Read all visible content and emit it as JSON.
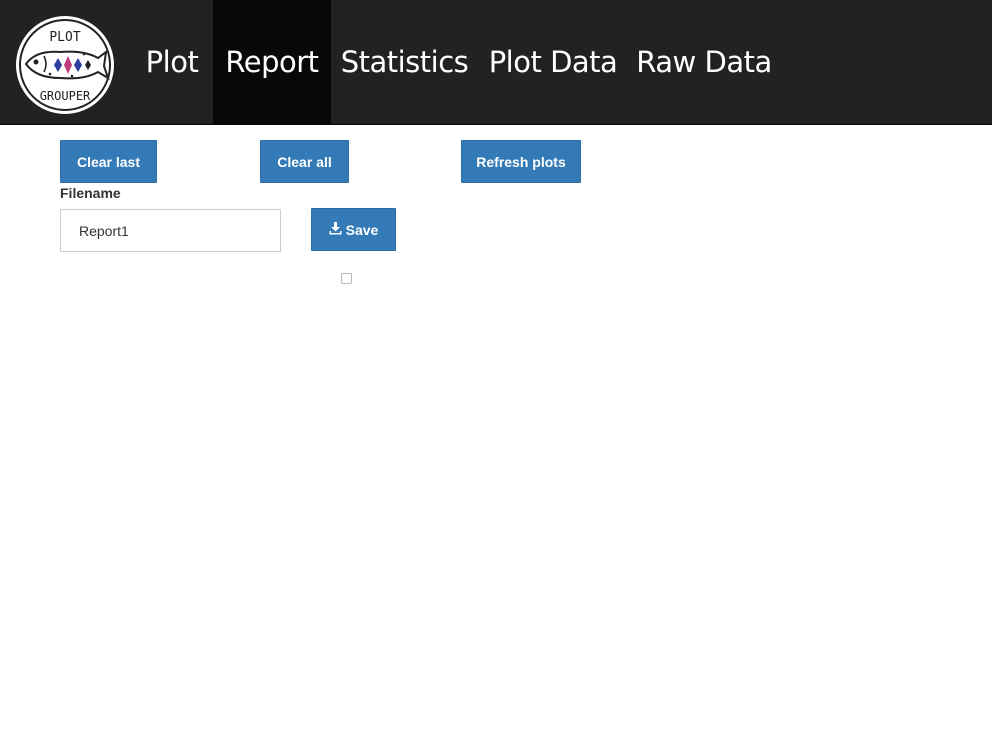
{
  "nav": {
    "tabs": [
      {
        "label": "Plot"
      },
      {
        "label": "Report"
      },
      {
        "label": "Statistics"
      },
      {
        "label": "Plot Data"
      },
      {
        "label": "Raw Data"
      }
    ],
    "active_tab": "Report"
  },
  "logo": {
    "text_top": "PLOT",
    "text_bottom": "GROUPER"
  },
  "toolbar": {
    "clear_last_label": "Clear last",
    "clear_all_label": "Clear all",
    "refresh_plots_label": "Refresh plots"
  },
  "save_form": {
    "filename_label": "Filename",
    "filename_value": "Report1",
    "save_label": "Save"
  },
  "colors": {
    "navbar": "#222222",
    "active_tab": "#080808",
    "button": "#337ab7"
  },
  "icons": {
    "logo": "grouper-fish-logo",
    "save": "download-icon"
  }
}
